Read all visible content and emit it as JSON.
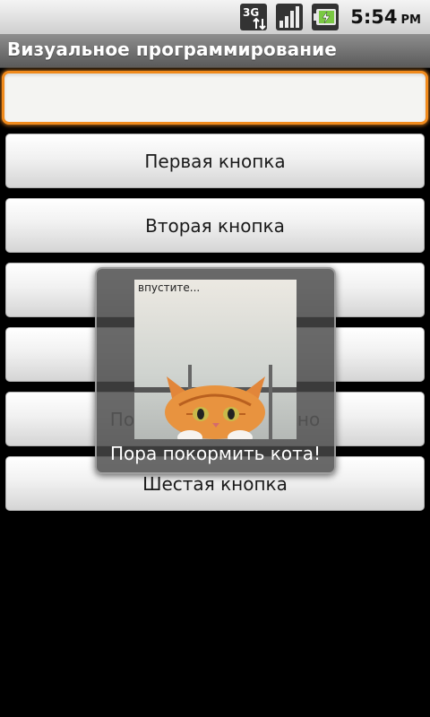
{
  "status_bar": {
    "network_label": "3G",
    "time": "5:54",
    "ampm": "PM",
    "icons": [
      "3g-data-icon",
      "signal-strength-icon",
      "battery-charging-icon"
    ]
  },
  "app": {
    "title": "Визуальное программирование"
  },
  "edit_text": {
    "value": "",
    "placeholder": ""
  },
  "buttons": [
    "Первая кнопка",
    "Вторая кнопка",
    "",
    "",
    "Покормить кота! окно",
    "Шестая кнопка"
  ],
  "toast": {
    "image_caption": "впустите...",
    "message": "Пора покормить кота!"
  }
}
